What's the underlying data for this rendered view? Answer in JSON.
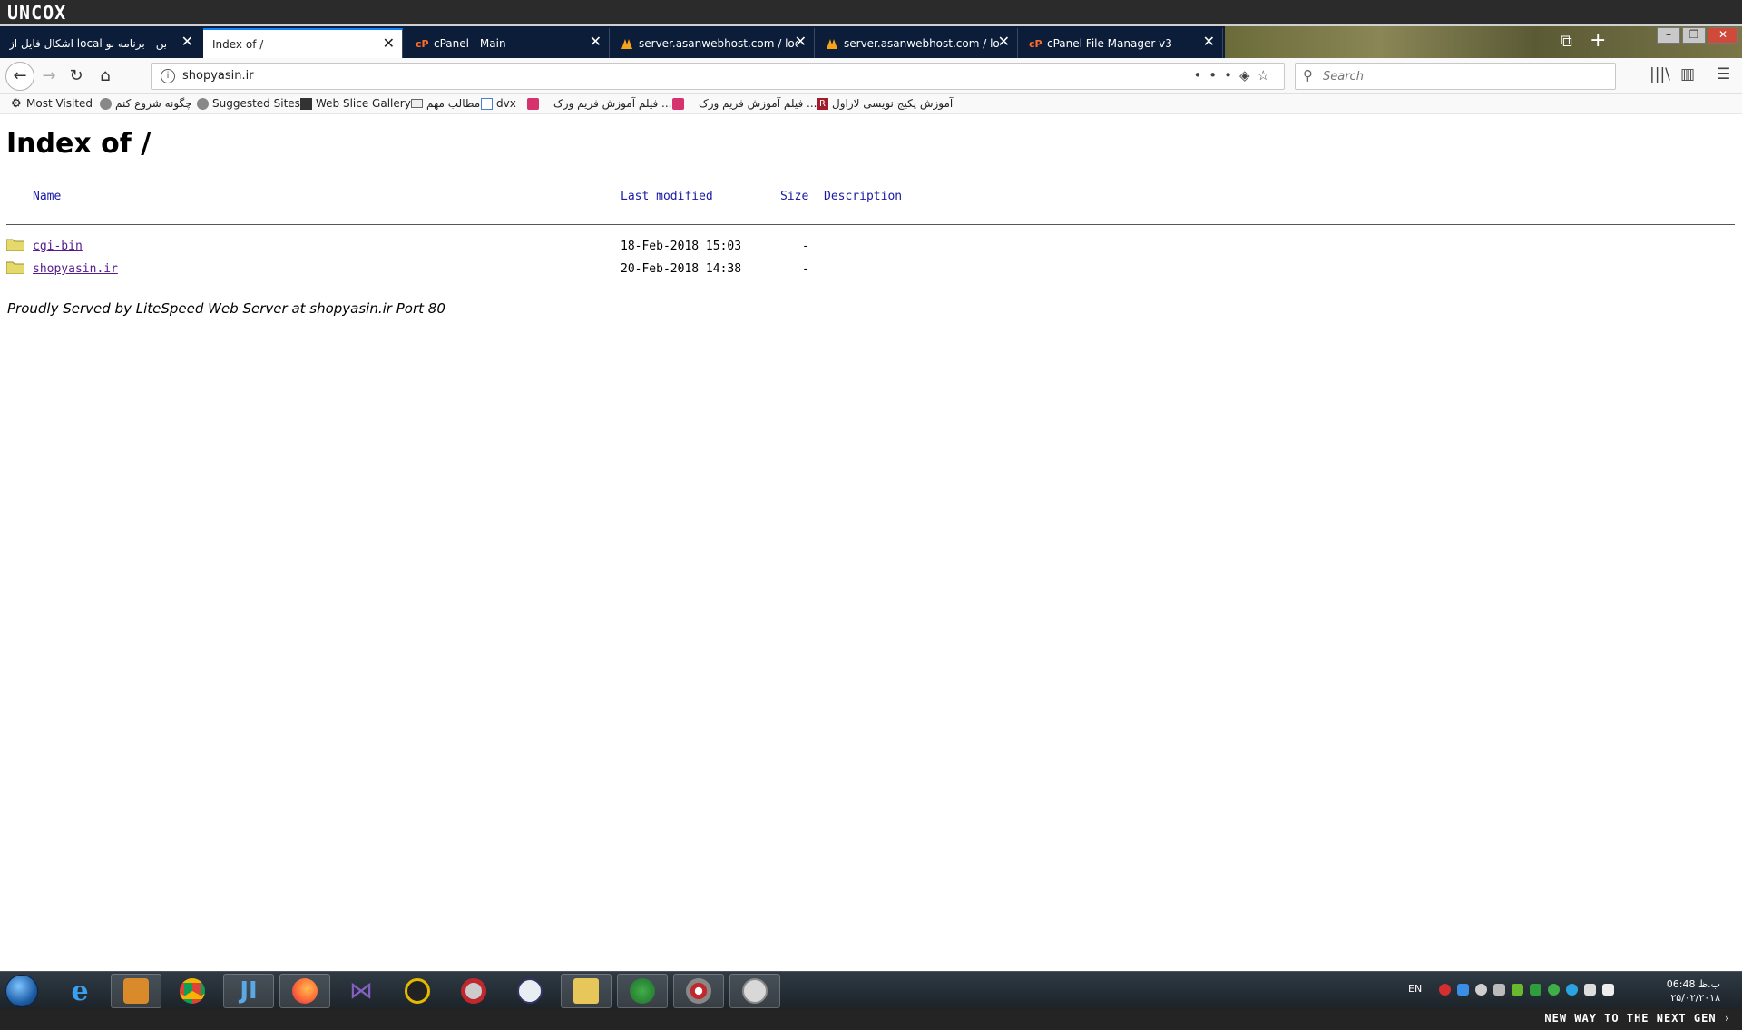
{
  "system": {
    "brand": "UNCOX",
    "tagline": "NEW WAY TO THE NEXT GEN ›"
  },
  "tabs": [
    {
      "label": "اشکال فایل از local به انلاین - برنامه نو",
      "active": false
    },
    {
      "label": "Index of /",
      "active": true
    },
    {
      "label": "cPanel - Main",
      "active": false
    },
    {
      "label": "server.asanwebhost.com / loca",
      "active": false
    },
    {
      "label": "server.asanwebhost.com / loca",
      "active": false
    },
    {
      "label": "cPanel File Manager v3",
      "active": false
    }
  ],
  "navbar": {
    "url": "shopyasin.ir",
    "search_placeholder": "Search",
    "page_actions": "•••"
  },
  "bookmarks": [
    {
      "label": "Most Visited",
      "icon": "gear-icon"
    },
    {
      "label": "چگونه شروع کنم",
      "icon": "globe-icon"
    },
    {
      "label": "Suggested Sites",
      "icon": "globe-icon"
    },
    {
      "label": "Web Slice Gallery",
      "icon": "webslice-icon"
    },
    {
      "label": "مطالب مهم",
      "icon": "folder-icon"
    },
    {
      "label": "dvx",
      "icon": "page-icon"
    },
    {
      "label": "فیلم آموزش فریم ورک ...",
      "icon": "pink-icon"
    },
    {
      "label": "فیلم آموزش فریم ورک ...",
      "icon": "pink-icon"
    },
    {
      "label": "آموزش پکیج نویسی لاراول",
      "icon": "red-r-icon"
    }
  ],
  "page": {
    "title": "Index of /",
    "columns": {
      "name": "Name",
      "modified": "Last modified",
      "size": "Size",
      "description": "Description"
    },
    "entries": [
      {
        "name": "cgi-bin",
        "modified": "18-Feb-2018 15:03",
        "size": "-"
      },
      {
        "name": "shopyasin.ir",
        "modified": "20-Feb-2018 14:38",
        "size": "-"
      }
    ],
    "footer": "Proudly Served by LiteSpeed Web Server at shopyasin.ir Port 80"
  },
  "taskbar": {
    "language": "EN",
    "time": "06:48 ب.ظ",
    "date": "۲۵/۰۲/۲۰۱۸"
  },
  "colors": {
    "link": "#1a1aa6",
    "visited": "#551a8b",
    "tabbar": "#0c1d3a",
    "accent": "#0a84ff"
  }
}
